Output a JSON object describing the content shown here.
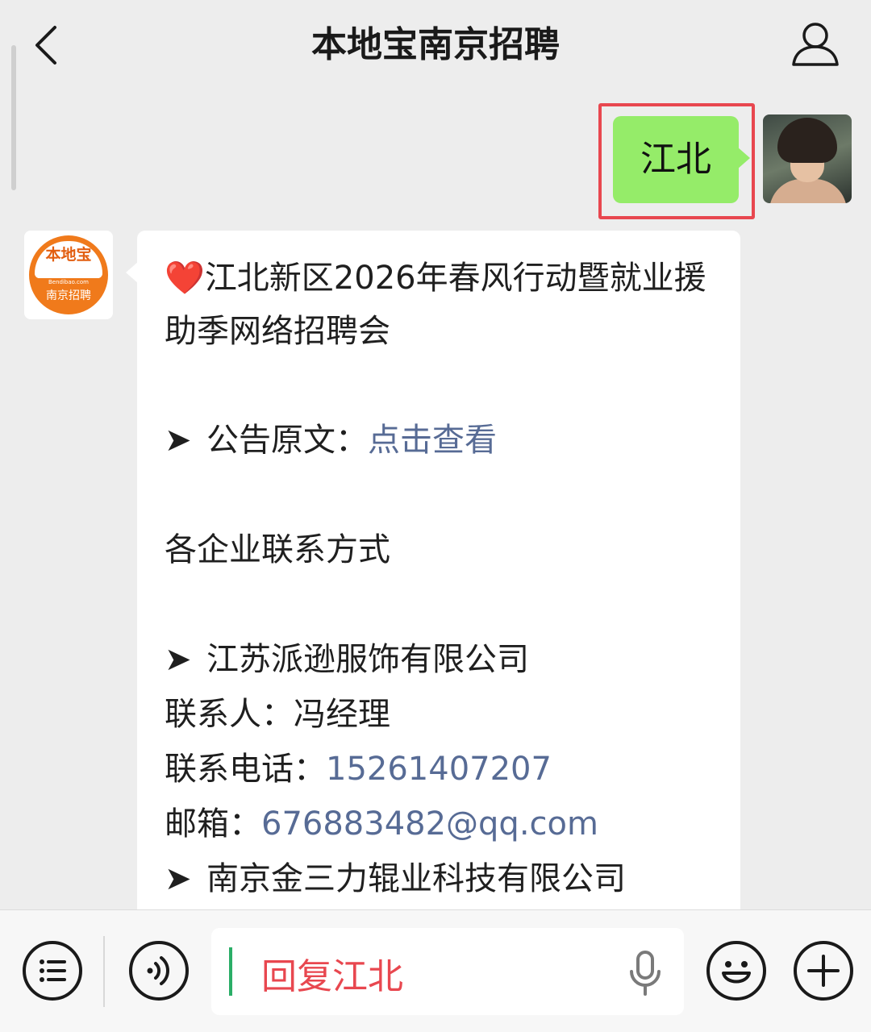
{
  "header": {
    "title": "本地宝南京招聘"
  },
  "outgoing": {
    "text": "江北"
  },
  "brand_avatar": {
    "top": "本地宝",
    "url": "Bendibao.com",
    "bottom": "南京招聘"
  },
  "message": {
    "heart": "❤️",
    "heading": "江北新区2026年春风行动暨就业援助季网络招聘会",
    "arrow": "➤",
    "notice_label": "公告原文：",
    "notice_link": "点击查看",
    "contacts_title": "各企业联系方式",
    "company1": {
      "name": "江苏派逊服饰有限公司",
      "contact_label": "联系人：",
      "contact": "冯经理",
      "phone_label": "联系电话：",
      "phone": "15261407207",
      "email_label": "邮箱：",
      "email": "676883482@qq.com"
    },
    "company2": {
      "name": "南京金三力辊业科技有限公司"
    }
  },
  "input": {
    "placeholder": "回复江北"
  },
  "colors": {
    "outgoing_bubble": "#95ec69",
    "link": "#576b95",
    "highlight": "#e8474f",
    "reply_text": "#e8474f"
  }
}
